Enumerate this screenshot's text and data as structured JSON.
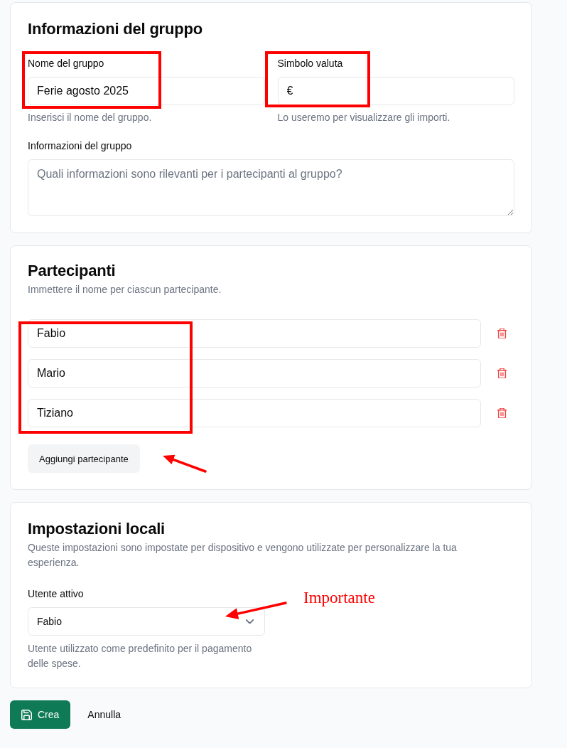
{
  "group_info": {
    "title": "Informazioni del gruppo",
    "name_field": {
      "label": "Nome del gruppo",
      "value": "Ferie agosto 2025",
      "description": "Inserisci il nome del gruppo."
    },
    "currency_field": {
      "label": "Simbolo valuta",
      "value": "€",
      "description": "Lo useremo per visualizzare gli importi."
    },
    "info_field": {
      "label": "Informazioni del gruppo",
      "placeholder": "Quali informazioni sono rilevanti per i partecipanti al gruppo?"
    }
  },
  "participants": {
    "title": "Partecipanti",
    "description": "Immettere il nome per ciascun partecipante.",
    "items": [
      {
        "name": "Fabio"
      },
      {
        "name": "Mario"
      },
      {
        "name": "Tiziano"
      }
    ],
    "add_button": "Aggiungi partecipante"
  },
  "local_settings": {
    "title": "Impostazioni locali",
    "description": "Queste impostazioni sono impostate per dispositivo e vengono utilizzate per personalizzare la tua esperienza.",
    "active_user": {
      "label": "Utente attivo",
      "value": "Fabio",
      "description": "Utente utilizzato come predefinito per il pagamento delle spese."
    }
  },
  "actions": {
    "primary": "Crea",
    "secondary": "Annulla"
  },
  "annotations": [
    {
      "kind": "frame"
    },
    {
      "kind": "frame"
    },
    {
      "kind": "frame"
    },
    {
      "kind": "arrow"
    },
    {
      "kind": "arrow"
    },
    {
      "kind": "note",
      "text": "Importante"
    }
  ]
}
